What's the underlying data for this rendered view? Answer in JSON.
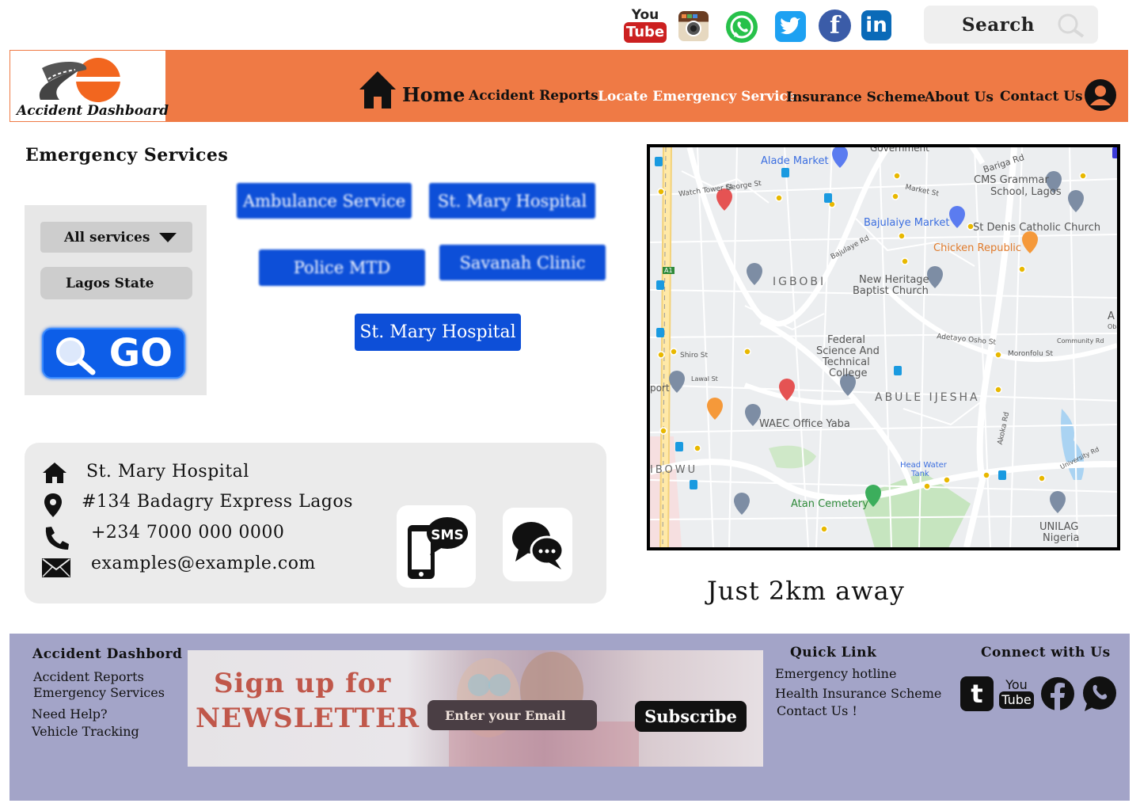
{
  "social_bar": {
    "youtube": {
      "line1": "You",
      "line2": "Tube"
    },
    "icons": [
      "youtube-icon",
      "instagram-icon",
      "whatsapp-icon",
      "twitter-icon",
      "facebook-icon",
      "linkedin-icon"
    ]
  },
  "search": {
    "label": "Search"
  },
  "header": {
    "logo_text": "Accident Dashboard",
    "nav": {
      "home": "Home",
      "accident_reports": "Accident Reports",
      "locate_emergency": "Locate Emergency Service",
      "insurance": "Insurance Scheme",
      "about": "About Us",
      "contact": "Contact Us"
    },
    "active_nav": "locate_emergency"
  },
  "emergency": {
    "title": "Emergency Services",
    "filters": {
      "service": "All services",
      "location": "Lagos State"
    },
    "go_label": "GO",
    "services": {
      "ambulance": "Ambulance Service",
      "st_mary": "St. Mary Hospital",
      "police": "Police MTD",
      "savanah": "Savanah Clinic",
      "selected": "St. Mary Hospital"
    }
  },
  "details": {
    "name": "St. Mary Hospital",
    "address": "#134 Badagry Express Lagos",
    "phone": "+234 7000 000 0000",
    "email": "examples@example.com",
    "sms_label": "SMS"
  },
  "map": {
    "labels": {
      "alade": "Alade Market",
      "bariga": "Bariga Rd",
      "cms": "CMS Grammar",
      "cms2": "School, Lagos",
      "government": "Government",
      "watch": "Watch Tower St",
      "george": "George St",
      "market": "Market St",
      "bajulaiye": "Bajulaiye Market",
      "stdenis": "St Denis Catholic Church",
      "chicken": "Chicken Republic",
      "igbobi": "IGBOBI",
      "newheritage": "New Heritage",
      "baptist": "Baptist Church",
      "bajulaye": "Bajulaye Rd",
      "ak": "AK",
      "obayan": "Obayan",
      "federal1": "Federal",
      "federal2": "Science And",
      "federal3": "Technical",
      "federal4": "College",
      "adetayo": "Adetayo Osho St",
      "community": "Community Rd",
      "moronfolu": "Moronfolu St",
      "shiro": "Shiro St",
      "lawal": "Lawal St",
      "port": "port",
      "abule": "ABULE IJESHA",
      "waec": "WAEC Office Yaba",
      "ibowu": "IBOWU",
      "headwater1": "Head Water",
      "headwater2": "Tank",
      "atan": "Atan Cemetery",
      "unilag1": "UNILAG",
      "unilag2": "Nigeria",
      "akoka": "Akoka Rd",
      "university": "University Rd",
      "a1": "A1"
    }
  },
  "distance_text": "Just 2km away",
  "footer": {
    "col1": {
      "title": "Accident Dashbord",
      "links": [
        "Accident Reports",
        "Emergency Services",
        "Need Help?",
        "Vehicle Tracking"
      ]
    },
    "newsletter": {
      "line1": "Sign up for",
      "line2": "NEWSLETTER",
      "email_placeholder": "Enter your Email",
      "subscribe_label": "Subscribe"
    },
    "quick": {
      "title": "Quick Link",
      "links": [
        "Emergency hotline",
        "Health Insurance Scheme",
        "Contact Us !"
      ]
    },
    "connect": {
      "title": "Connect with Us",
      "tumblr": "t",
      "youtube": {
        "line1": "You",
        "line2": "Tube"
      }
    }
  },
  "colors": {
    "header_orange": "#ef7a45",
    "button_blue": "#0d4fd8",
    "footer_lavender": "#a3a4c8"
  }
}
